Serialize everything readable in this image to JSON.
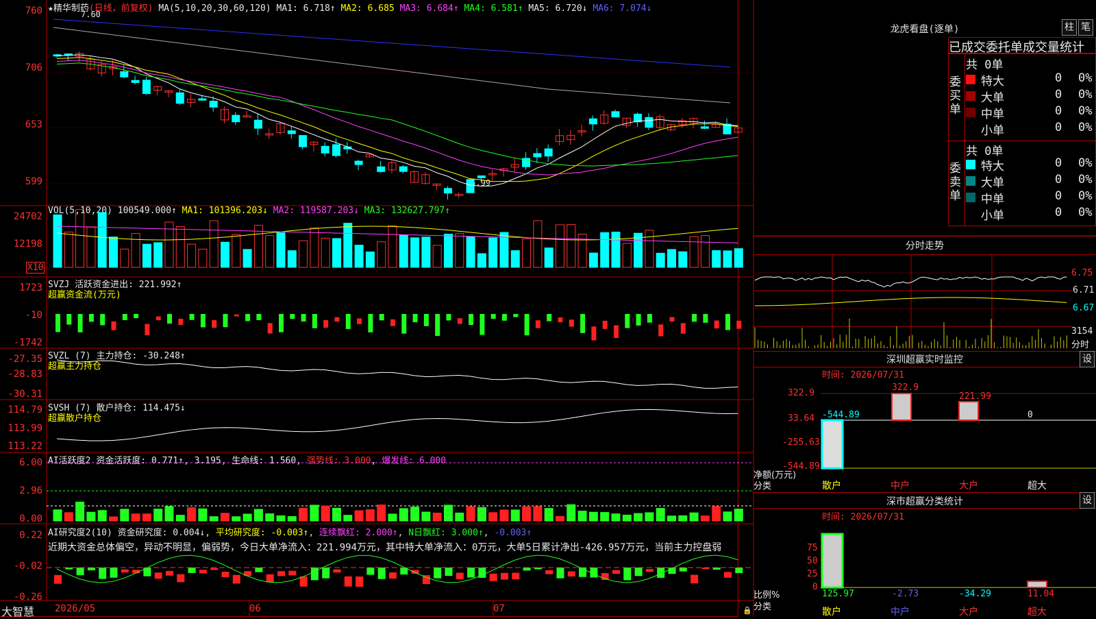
{
  "brand": "大智慧",
  "main_chart": {
    "star": "★",
    "stock_name": "精华制药",
    "period": "(日线，前复权)",
    "ma_text": "MA(5,10,20,30,60,120)",
    "ma1": "MA1: 6.718↑",
    "ma2": "MA2: 6.685",
    "ma3": "MA3: 6.684↑",
    "ma4": "MA4: 6.581↑",
    "ma5": "MA5: 6.720↓",
    "ma6": "MA6: 7.074↓",
    "high_mark": "7.60",
    "low_mark": "←5.99",
    "y_labels": [
      "760",
      "706",
      "653",
      "599"
    ]
  },
  "vol_panel": {
    "title": "VOL(5,10,20)",
    "value": "100549.000↑",
    "ma1": "MA1: 101396.203↓",
    "ma2": "MA2: 119587.203↓",
    "ma3": "MA3: 132627.797↑",
    "y_labels": [
      "24702",
      "12198"
    ],
    "unit": "X10"
  },
  "svzj_panel": {
    "title": "SVZJ",
    "label": "活跃资金进出: 221.992↑",
    "subtitle": "超赢资金流(万元)",
    "y_labels": [
      "1723",
      "-10",
      "-1742"
    ]
  },
  "svzl_panel": {
    "title": "SVZL (7)",
    "label": "主力持仓: -30.248↑",
    "subtitle": "超赢主力持仓",
    "y_labels": [
      "-27.35",
      "-28.83",
      "-30.31"
    ]
  },
  "svsh_panel": {
    "title": "SVSH (7)",
    "label": "散户持仓: 114.475↓",
    "subtitle": "超赢散户持仓",
    "y_labels": [
      "114.79",
      "113.99",
      "113.22"
    ]
  },
  "ai_active": {
    "title": "AI活跃度2",
    "t1": "资金活跃度: 0.771↑",
    "t2": "3.195",
    "t3": "生命线: 1.560",
    "t4": "强势线: 3.000",
    "t5": "爆发线: 6.000",
    "y_labels": [
      "6.00",
      "2.96",
      "0.00"
    ]
  },
  "ai_research": {
    "title": "AI研究度2(10)",
    "t1": "资金研究度: 0.004↓",
    "t2": "平均研究度: -0.003↑",
    "t3": "连续飘红: 2.000↑",
    "t4": "N日飘红: 3.000↑",
    "t5": "-0.003↑",
    "comment": "近期大资金总体偏空，异动不明显，偏弱势，今日大单净流入：221.994万元，其中特大单净流入：0万元，大单5日累计净出-426.957万元，当前主力控盘弱",
    "y_labels": [
      "0.22",
      "-0.02",
      "-0.26"
    ]
  },
  "x_axis": [
    "2026/05",
    "06",
    "07"
  ],
  "right": {
    "lhb_title": "龙虎看盘(逐单)",
    "btn_a": "柱",
    "btn_b": "笔",
    "header": "已成交委托单成交量统计",
    "buy_label": "委买单",
    "sell_label": "委卖单",
    "buy_total": "共 0单",
    "sell_total": "共 0单",
    "buy_rows": [
      {
        "name": "特大",
        "n": "0",
        "p": "0%",
        "color": "#ff1010"
      },
      {
        "name": "大单",
        "n": "0",
        "p": "0%",
        "color": "#a00000"
      },
      {
        "name": "中单",
        "n": "0",
        "p": "0%",
        "color": "#700000"
      },
      {
        "name": "小单",
        "n": "0",
        "p": "0%",
        "color": ""
      }
    ],
    "sell_rows": [
      {
        "name": "特大",
        "n": "0",
        "p": "0%",
        "color": "#00ffff"
      },
      {
        "name": "大单",
        "n": "0",
        "p": "0%",
        "color": "#008888"
      },
      {
        "name": "中单",
        "n": "0",
        "p": "0%",
        "color": "#006868"
      },
      {
        "name": "小单",
        "n": "0",
        "p": "0%",
        "color": ""
      }
    ],
    "minute_title": "分时走势",
    "minute_y": [
      "6.75",
      "6.71",
      "6.67"
    ],
    "minute_vol": "3154",
    "minute_unit": "分时",
    "monitor_title": "深圳超赢实时监控",
    "monitor_btn": "设",
    "monitor_time": "时间: 2026/07/31",
    "monitor_y": [
      "322.9",
      "33.64",
      "-255.63",
      "-544.89"
    ],
    "monitor_vals": [
      "-544.89",
      "322.9",
      "221.99",
      "0"
    ],
    "monitor_axis_a": "净额(万元)",
    "monitor_axis_b": "分类",
    "cats": [
      "散户",
      "中户",
      "大户",
      "超大"
    ],
    "class_title": "深市超赢分类统计",
    "class_btn": "设",
    "class_time": "时间: 2026/07/31",
    "class_y": [
      "75",
      "50",
      "25",
      "0"
    ],
    "class_vals": [
      "125.97",
      "-2.73",
      "-34.29",
      "11.04"
    ],
    "class_axis_a": "比例%",
    "class_axis_b": "分类"
  },
  "colors": {
    "up": "#ff3030",
    "down": "#00ffff",
    "grid": "#b00000"
  }
}
